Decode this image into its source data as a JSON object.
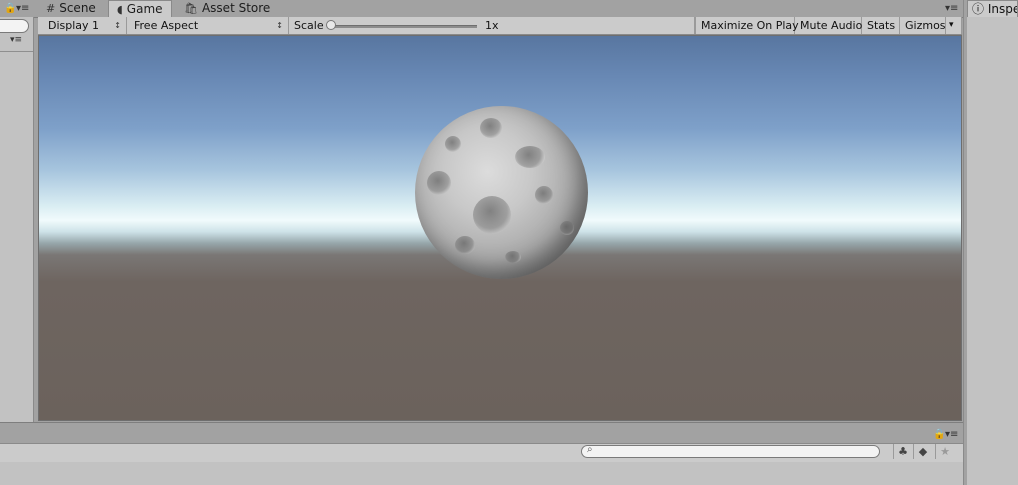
{
  "tabs": {
    "scene": "Scene",
    "game": "Game",
    "asset_store": "Asset Store",
    "inspector": "Inspe"
  },
  "icons": {
    "scene": "grid-icon",
    "game": "pacman-icon",
    "asset_store": "shopping-bag-icon",
    "inspector": "info-icon",
    "lock": "lock-icon",
    "menu": "menu-icon"
  },
  "game_toolbar": {
    "display": "Display 1",
    "aspect": "Free Aspect",
    "scale_label": "Scale",
    "scale_value": "1x",
    "scale_slider_fraction": 0.0,
    "maximize": "Maximize On Play",
    "mute": "Mute Audio",
    "stats": "Stats",
    "gizmos": "Gizmos"
  },
  "glyphs": {
    "dropdown": "▾",
    "updown": "↕",
    "lock": "🔒",
    "menu": "▾≡",
    "scene": "#",
    "game": "◖",
    "asset_store": "🛍",
    "info": "ⓘ",
    "search": "⌕",
    "tag": "◆",
    "star": "★",
    "filter": "♣"
  },
  "colors": {
    "panel": "#a2a2a2",
    "toolbar": "#cbcbcb",
    "sky_top": "#5876a0",
    "horizon": "#f1fbfc",
    "ground": "#6b625c"
  }
}
